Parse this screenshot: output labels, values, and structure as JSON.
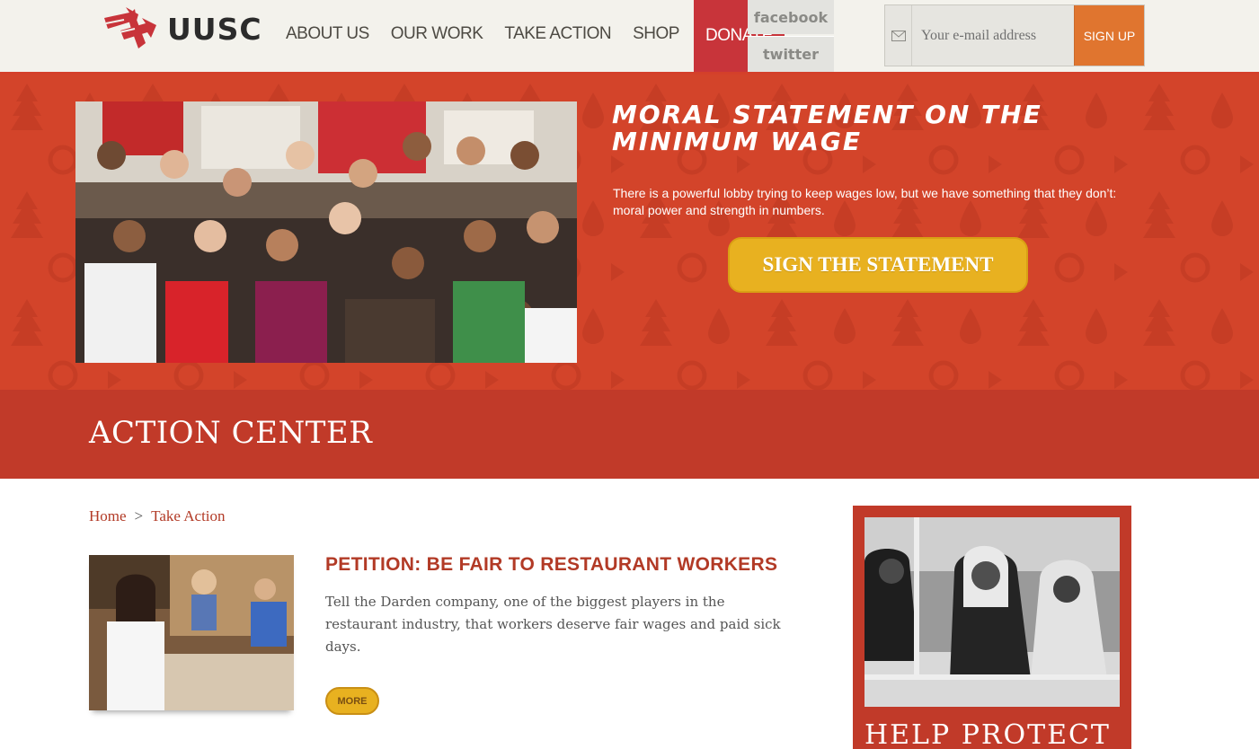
{
  "header": {
    "logo_text": "UUSC",
    "nav": [
      {
        "label": "ABOUT US"
      },
      {
        "label": "OUR WORK"
      },
      {
        "label": "TAKE ACTION"
      },
      {
        "label": "SHOP"
      },
      {
        "label": "DONATE"
      }
    ],
    "social": {
      "facebook": "facebook",
      "twitter": "twitter"
    },
    "signup": {
      "placeholder": "Your e-mail address",
      "button": "SIGN UP"
    }
  },
  "hero": {
    "title": "MORAL STATEMENT ON THE MINIMUM WAGE",
    "text": "There is a powerful lobby trying to keep wages low, but we have something that they don’t: moral power and strength in numbers.",
    "cta": "SIGN THE STATEMENT"
  },
  "band": {
    "title": "ACTION CENTER"
  },
  "breadcrumb": {
    "home": "Home",
    "separator": ">",
    "current": "Take Action"
  },
  "article": {
    "title": "PETITION: BE FAIR TO RESTAURANT WORKERS",
    "text": "Tell the Darden company, one of the biggest players in the restaurant industry, that workers deserve fair wages and paid sick days.",
    "more": "MORE"
  },
  "sidebar": {
    "title": "HELP PROTECT"
  },
  "colors": {
    "brand_red": "#c8343a",
    "hero_orange": "#d3442a",
    "band_red": "#c13a29",
    "cta_yellow": "#e8b120",
    "signup_orange": "#e0752f",
    "link_red": "#b23a26"
  }
}
